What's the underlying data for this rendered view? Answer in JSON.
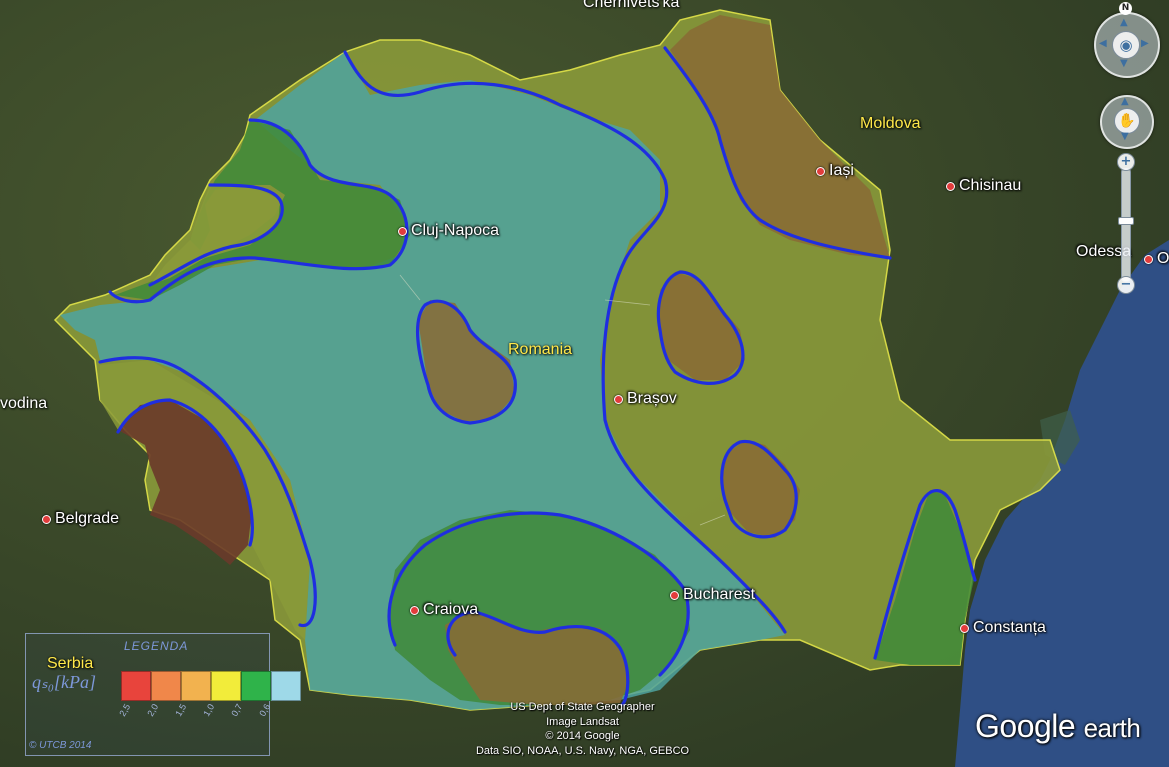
{
  "labels": {
    "chernivtsi": "Chernivets'ka",
    "moldova": "Moldova",
    "romania": "Romania",
    "serbia": "Serbia",
    "vojvodina": "vodina",
    "cities": {
      "iasi": "Iași",
      "chisinau": "Chisinau",
      "odessa": "Odessa",
      "odessa_cut": "Od",
      "cluj": "Cluj-Napoca",
      "brasov": "Brașov",
      "belgrade": "Belgrade",
      "bucharest": "Bucharest",
      "craiova": "Craiova",
      "constanta": "Constanța"
    }
  },
  "legend": {
    "title": "LEGENDA",
    "quantity": "qₛ₀[kPa]",
    "items": [
      {
        "color": "#e8443c",
        "label": "2,5"
      },
      {
        "color": "#f0874a",
        "label": "2,0"
      },
      {
        "color": "#f2b24f",
        "label": "1,5"
      },
      {
        "color": "#f2ec3a",
        "label": "1,0"
      },
      {
        "color": "#2fb34a",
        "label": "0,7"
      },
      {
        "color": "#9ed9e8",
        "label": "0,6"
      }
    ],
    "copyright": "© UTCB 2014"
  },
  "attribution": [
    "US Dept of State Geographer",
    "Image Landsat",
    "© 2014 Google",
    "Data SIO, NOAA, U.S. Navy, NGA, GEBCO"
  ],
  "brand": {
    "google": "Google",
    "earth": "earth"
  },
  "controls": {
    "north": "N",
    "zoom_in": "+",
    "zoom_out": "−"
  },
  "zone_colors": {
    "lowest": "#4fa3a0",
    "yellow": "#8a9a3a",
    "green": "#3f8a3a",
    "orange": "#8a6a35",
    "red": "#6a3a2a",
    "contour": "#1f2ee0",
    "border": "#e6e84a",
    "sea": "#2f4f85"
  }
}
